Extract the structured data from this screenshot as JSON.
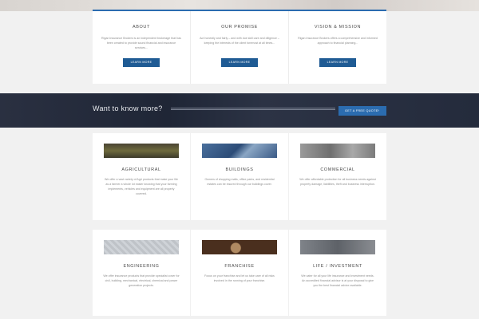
{
  "about": [
    {
      "title": "ABOUT",
      "text": "Rigan Insurance Brokers is an independent brokerage that has been created to provide sound financial and insurance services...",
      "button": "LEARN MORE"
    },
    {
      "title": "OUR PROMISE",
      "text": "Act honestly and fairly – and with due skill care and diligence – keeping the interests of the client foremost at all times...",
      "button": "LEARN MORE"
    },
    {
      "title": "VISION & MISSION",
      "text": "Rigan Insurance Brokers offers a comprehensive and informed approach to financial planning...",
      "button": "LEARN MORE"
    }
  ],
  "cta": {
    "text": "Want to know more?",
    "button": "GET A FREE QUOTE",
    "chevron": "›"
  },
  "cards_row1": [
    {
      "title": "AGRICULTURAL",
      "icon": "agriculture-photo",
      "text": "We offer a vast variety of Agri products that make your life as a farmer a whole lot easier knowing that your farming implements, vehicles and equipment are all properly covered."
    },
    {
      "title": "BUILDINGS",
      "icon": "buildings-photo",
      "text": "Owners of shopping malls, office parks, and residential estates can be insured through our buildings cover."
    },
    {
      "title": "COMMERCIAL",
      "icon": "commercial-photo",
      "text": "We offer affordable protection for all business needs against property damage, liabilities, theft and business interruption."
    }
  ],
  "cards_row2": [
    {
      "title": "ENGINEERING",
      "icon": "engineering-photo",
      "text": "We offer insurance products that provide specialist cover for civil, building, mechanical, electrical, chemical and power generation projects."
    },
    {
      "title": "FRANCHISE",
      "icon": "franchise-photo",
      "text": "Focus on your franchise and let us take care of all risks involved in the running of your franchise."
    },
    {
      "title": "LIFE / INVESTMENT",
      "icon": "life-investment-photo",
      "text": "We cater for all your life insurance and investment needs. An accredited financial advisor is at your disposal to give you the best financial advice available."
    }
  ]
}
